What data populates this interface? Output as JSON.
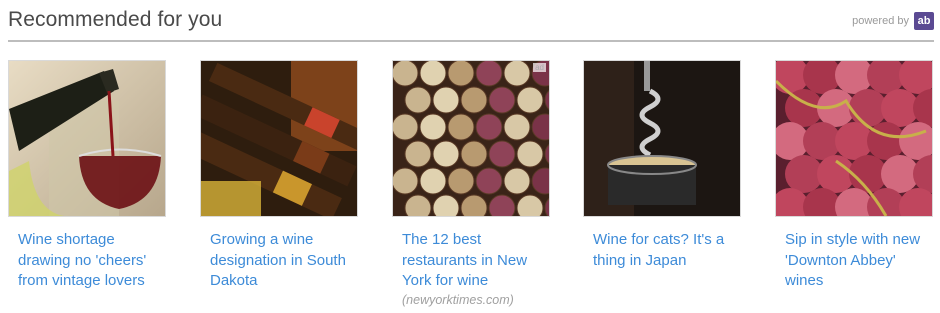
{
  "header": {
    "title": "Recommended for you",
    "powered_by_label": "powered by",
    "badge_text": "ab"
  },
  "cards": [
    {
      "headline": "Wine shortage drawing no 'cheers' from vintage lovers",
      "image": "wine-pour-photo"
    },
    {
      "headline": "Growing a wine designation in South Dakota",
      "image": "wine-bottles-photo"
    },
    {
      "headline": "The 12 best restaurants in New York for wine",
      "source": "(newyorktimes.com)",
      "ad_label": "ad",
      "image": "wine-corks-photo"
    },
    {
      "headline": "Wine for cats? It's a thing in Japan",
      "image": "corkscrew-photo"
    },
    {
      "headline": "Sip in style with new 'Downton Abbey' wines",
      "image": "red-grapes-photo"
    }
  ],
  "colors": {
    "link": "#3d8bd8",
    "badge": "#5b4a93",
    "divider": "#bdbdbd"
  }
}
